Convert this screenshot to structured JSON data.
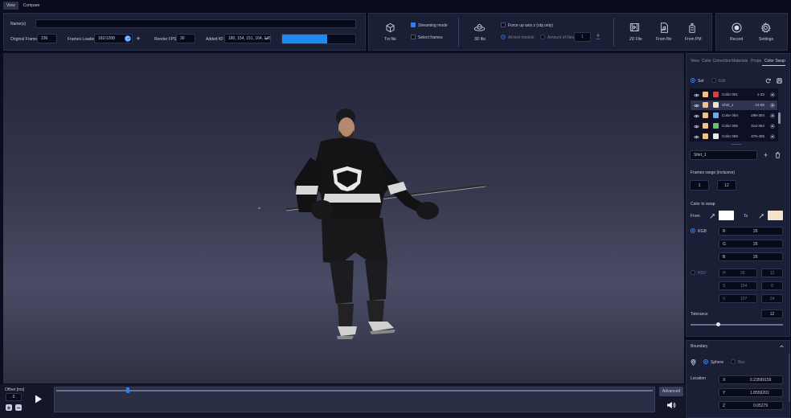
{
  "top_tabs": [
    {
      "label": "View",
      "active": true
    },
    {
      "label": "Compare",
      "active": false
    }
  ],
  "params": {
    "names_label": "Name(s)",
    "names_value": "",
    "original_frame_label": "Original Frame",
    "original_frame_value": "236",
    "frames_loaded_label": "Frames Loaded",
    "frames_loaded_value": "182/1288",
    "render_fps_label": "Render FPS",
    "render_fps_value": "30",
    "added_kf_label": "Added KF",
    "added_kf_value": "180, 154, 151, 164, 145",
    "progress": 0.62
  },
  "import": {
    "txt_file": "Txt file",
    "streaming_mode": "Streaming mode",
    "select_frames": "Select frames",
    "file_3d": "3D file",
    "force_up_axis": "Force up axis z (obj only)",
    "all_text_models": "All text models",
    "amount_of_files": "Amount of files",
    "amount_value": "1",
    "file_2d": "2D File",
    "from_file": "From file",
    "from_pm": "From PM"
  },
  "actions": {
    "record": "Record",
    "settings": "Settings"
  },
  "right_tabs": [
    "View",
    "Color Correction",
    "Materials",
    "Props",
    "Color Swap"
  ],
  "swap": {
    "set": "Set",
    "edit": "Edit",
    "colors": [
      {
        "name": "Color 001",
        "range": "1-23",
        "color": "#e03b3b",
        "selected": false
      },
      {
        "name": "Shirt_1",
        "range": "24-85",
        "color": "#f6e2c6",
        "selected": true
      },
      {
        "name": "Color 004",
        "range": "298-304",
        "color": "#6fa8e8",
        "selected": false
      },
      {
        "name": "Color 005",
        "range": "314-364",
        "color": "#61c462",
        "selected": false
      },
      {
        "name": "Color 008",
        "range": "379-405",
        "color": "#e7e7ee",
        "selected": false
      }
    ],
    "selected_name": "Shirt_1",
    "frames_range_label": "Frames range (inclusive)",
    "frames_from": "1",
    "frames_to_label": "to",
    "frames_to": "12",
    "color_to_swap": "Color to swap",
    "from": "From",
    "to": "To",
    "from_color": "#ffffff",
    "to_color": "#f6e2c6",
    "rgb": "RGB",
    "r": "R",
    "r_val": "26",
    "g": "G",
    "g_val": "26",
    "b": "B",
    "b_val": "26",
    "hsv": "HSV",
    "h": "H",
    "h_val": "26",
    "h_val2": "12",
    "s": "S",
    "s_val": "154",
    "s_val2": "8",
    "v": "V",
    "v_val": "107",
    "v_val2": "24",
    "tolerance": "Tolerance",
    "tolerance_val": "12",
    "tolerance_frac": 0.3
  },
  "boundary": {
    "title": "Boundary",
    "sphere": "Sphere",
    "box": "Box",
    "location": "Location",
    "x": "X",
    "x_val": "0.23599159",
    "y": "Y",
    "y_val": "1.8559201",
    "z": "Z",
    "z_val": "0.05279"
  },
  "timeline": {
    "offset_label": "Offset [ms]",
    "offset_value": "0",
    "advanced": "Advanced",
    "position": 0.12
  }
}
